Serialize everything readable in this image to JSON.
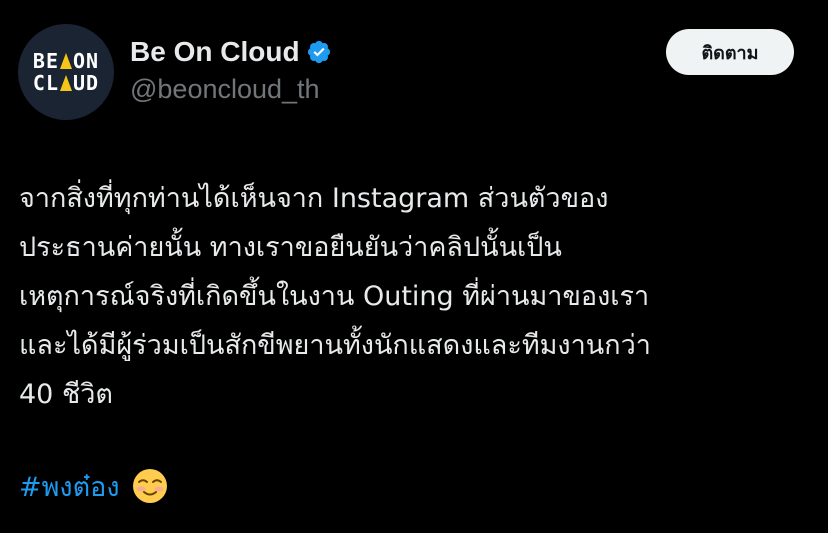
{
  "tweet": {
    "author": {
      "display_name": "Be On Cloud",
      "handle": "@beoncloud_th",
      "verified": true,
      "avatar_logo_line1": "BE  ON",
      "avatar_logo_line2": "CL  UD",
      "avatar_icon": "be-on-cloud-logo"
    },
    "follow_button_label": "ติดตาม",
    "body_lines": [
      "จากสิ่งที่ทุกท่านได้เห็นจาก Instagram ส่วนตัวของ",
      "ประธานค่ายนั้น ทางเราขอยืนยันว่าคลิปนั้นเป็น",
      "เหตุการณ์จริงที่เกิดขึ้นในงาน Outing ที่ผ่านมาของเรา",
      "และได้มีผู้ร่วมเป็นสักขีพยานทั้งนักแสดงและทีมงานกว่า",
      "40 ชีวิต"
    ],
    "hashtag": "#พงต๋อง",
    "emoji_icon": "smiling-face-emoji"
  },
  "colors": {
    "background": "#000000",
    "text_primary": "#e7e9ea",
    "text_secondary": "#71767b",
    "link": "#1d9bf0",
    "verified_badge": "#1d9bf0",
    "button_bg": "#eff3f4",
    "button_text": "#0f1419"
  }
}
